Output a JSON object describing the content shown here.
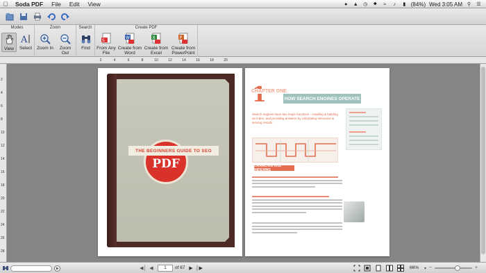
{
  "menubar": {
    "app_name": "Soda PDF",
    "menus": [
      "File",
      "Edit",
      "View"
    ],
    "battery": "(84%)",
    "clock": "Wed 3:05 AM"
  },
  "ribbon": {
    "groups": {
      "modes": "Modes",
      "zoom": "Zoom",
      "search": "Search",
      "create": "Create PDF"
    },
    "buttons": {
      "view": "View",
      "select": "Select",
      "zoom_in": "Zoom In",
      "zoom_out": "Zoom Out",
      "find": "Find",
      "from_any_file": "From Any\nFile",
      "from_word": "Create from\nWord",
      "from_excel": "Create from\nExcel",
      "from_powerpoint": "Create from\nPowerPoint"
    }
  },
  "ruler": {
    "h_ticks": [
      "2",
      "4",
      "6",
      "8",
      "10",
      "12",
      "14",
      "16",
      "18",
      "20"
    ],
    "v_ticks": [
      "2",
      "4",
      "6",
      "8",
      "10",
      "12",
      "14",
      "16",
      "18",
      "20",
      "22",
      "24",
      "26",
      "28"
    ]
  },
  "document": {
    "cover_banner": "THE BEGINNERS GUIDE TO SEO",
    "cover_seal": "PDF",
    "chapter_number": "1",
    "chapter_label": "CHAPTER ONE",
    "chapter_title": "HOW SEARCH ENGINES OPERATE",
    "intro_text": "Search engines have two major functions - crawling & building an index, and providing answers by calculating relevance & serving results.",
    "crawl_label": "CRAWLING AND INDEXING"
  },
  "bottombar": {
    "search_placeholder": "",
    "page_current": "1",
    "page_total_label": "of 67",
    "zoom_percent": "66%",
    "zoom_level": 0.62
  },
  "colors": {
    "accent": "#e36a4c",
    "teal": "#9fc2bd",
    "cover_red": "#d8322a"
  }
}
